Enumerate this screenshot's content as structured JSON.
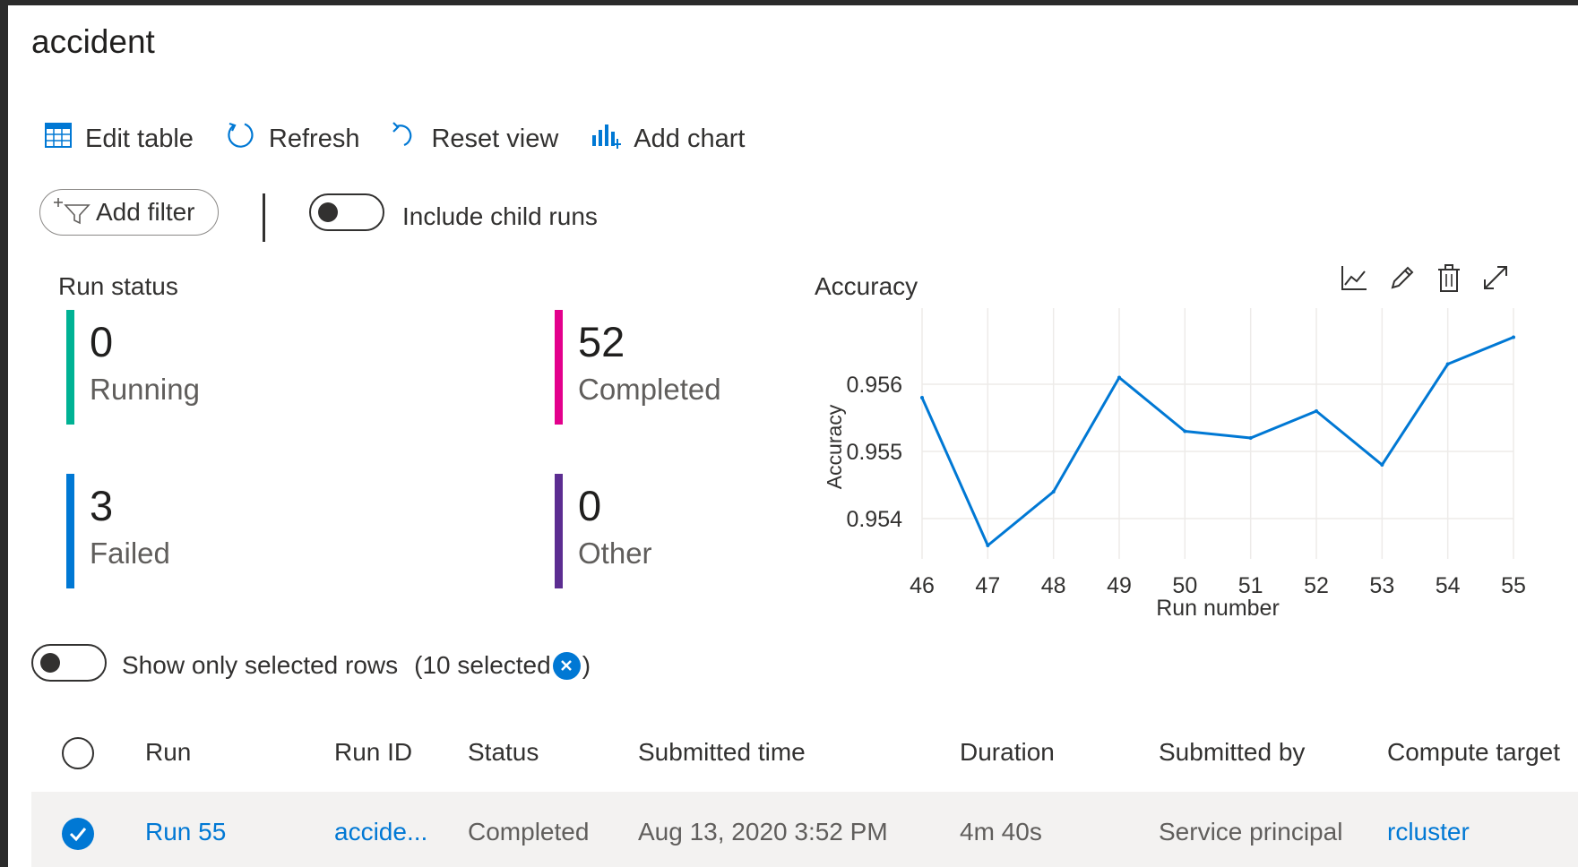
{
  "page": {
    "title": "accident"
  },
  "toolbar": {
    "edit_table": "Edit table",
    "refresh": "Refresh",
    "reset_view": "Reset view",
    "add_chart": "Add chart"
  },
  "filters": {
    "add_filter": "Add filter",
    "include_child_runs": "Include child runs",
    "include_child_runs_on": false
  },
  "run_status": {
    "title": "Run status",
    "items": [
      {
        "count": "0",
        "label": "Running",
        "color": "#00b294"
      },
      {
        "count": "52",
        "label": "Completed",
        "color": "#e3008c"
      },
      {
        "count": "3",
        "label": "Failed",
        "color": "#0078d4"
      },
      {
        "count": "0",
        "label": "Other",
        "color": "#5c2d91"
      }
    ]
  },
  "chart_card": {
    "icons": [
      "line-chart-icon",
      "edit-pencil-icon",
      "delete-trash-icon",
      "expand-icon"
    ]
  },
  "chart_data": {
    "type": "line",
    "title": "Accuracy",
    "xlabel": "Run number",
    "ylabel": "Accuracy",
    "x": [
      46,
      47,
      48,
      49,
      50,
      51,
      52,
      53,
      54,
      55
    ],
    "values": [
      0.9558,
      0.9536,
      0.9544,
      0.9561,
      0.9553,
      0.9552,
      0.9556,
      0.9548,
      0.9563,
      0.9567
    ],
    "yticks": [
      "0.954",
      "0.955",
      "0.956"
    ],
    "ylim": [
      0.9534,
      0.957
    ],
    "grid": true,
    "color": "#0078d4"
  },
  "selection": {
    "show_only_selected": "Show only selected rows",
    "selected_count": "(10 selected",
    "close_paren": ")"
  },
  "table": {
    "headers": [
      "Run",
      "Run ID",
      "Status",
      "Submitted time",
      "Duration",
      "Submitted by",
      "Compute target"
    ],
    "rows": [
      {
        "run": "Run 55",
        "run_id": "accide...",
        "status": "Completed",
        "submitted_time": "Aug 13, 2020 3:52 PM",
        "duration": "4m 40s",
        "submitted_by": "Service principal",
        "compute_target": "rcluster",
        "selected": true
      }
    ]
  }
}
